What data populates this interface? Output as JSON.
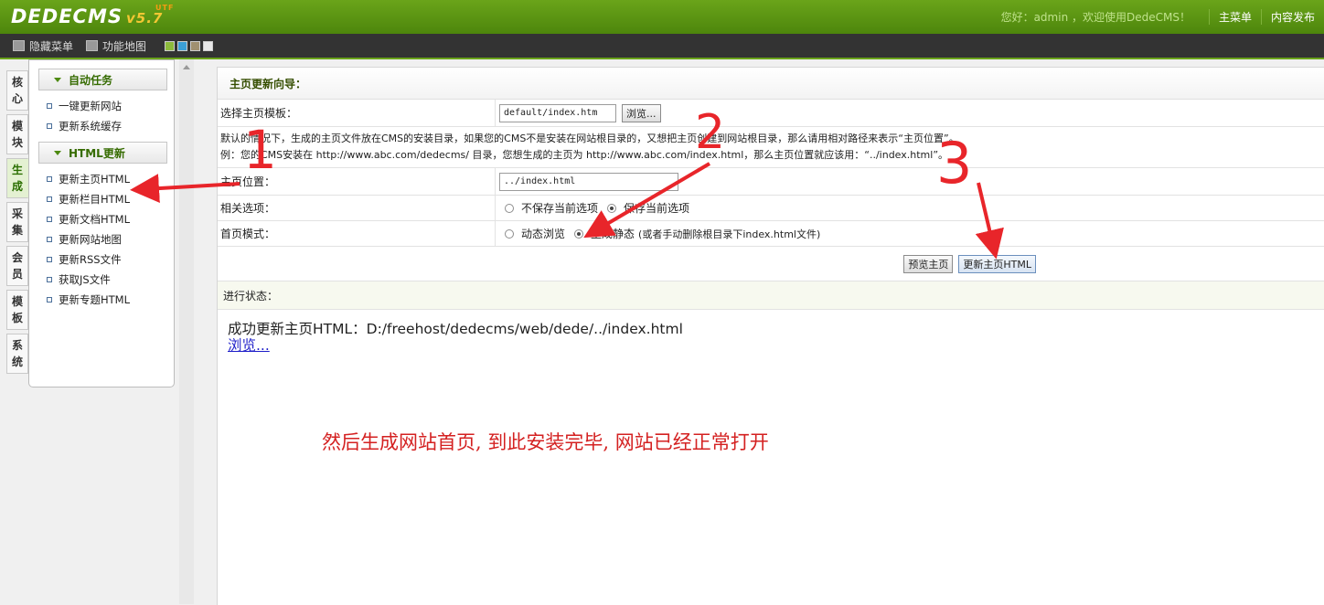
{
  "header": {
    "logo": "DEDECMS",
    "version": "v5.7",
    "edition": "UTF",
    "welcome": "您好：admin ，欢迎使用DedeCMS！",
    "nav": [
      "主菜单",
      "内容发布"
    ]
  },
  "toolbar": {
    "hide_menu": "隐藏菜单",
    "function_map": "功能地图",
    "swatches": [
      "#8dbb3c",
      "#3b9fd6",
      "#a09070",
      "#e8e8e8"
    ]
  },
  "side_tabs": [
    "核心",
    "模块",
    "生成",
    "采集",
    "会员",
    "模板",
    "系统"
  ],
  "active_tab": "生成",
  "menu": {
    "group1": {
      "title": "自动任务",
      "items": [
        "一键更新网站",
        "更新系统缓存"
      ]
    },
    "group2": {
      "title": "HTML更新",
      "items": [
        "更新主页HTML",
        "更新栏目HTML",
        "更新文档HTML",
        "更新网站地图",
        "更新RSS文件",
        "获取JS文件",
        "更新专题HTML"
      ]
    }
  },
  "main": {
    "title": "主页更新向导：",
    "template_label": "选择主页模板：",
    "template_value": "default/index.htm",
    "browse_button": "浏览...",
    "note_line1": "默认的情况下，生成的主页文件放在CMS的安装目录，如果您的CMS不是安装在网站根目录的，又想把主页创建到网站根目录，那么请用相对路径来表示“主页位置”。",
    "note_line2": "例：您的CMS安装在 http://www.abc.com/dedecms/ 目录，您想生成的主页为 http://www.abc.com/index.html，那么主页位置就应该用：“../index.html”。",
    "position_label": "主页位置：",
    "position_value": "../index.html",
    "options_label": "相关选项：",
    "option_no_save": "不保存当前选项",
    "option_save": "保存当前选项",
    "mode_label": "首页模式：",
    "mode_dynamic": "动态浏览",
    "mode_static": "生成静态",
    "mode_static_hint": "(或者手动删除根目录下index.html文件)",
    "preview_button": "预览主页",
    "update_button": "更新主页HTML",
    "status_label": "进行状态：",
    "result_text": "成功更新主页HTML：D:/freehost/dedecms/web/dede/../index.html",
    "result_link": "浏览..."
  },
  "annotations": {
    "caption": "然后生成网站首页, 到此安装完毕, 网站已经正常打开",
    "step1": "1",
    "step2": "2",
    "step3": "3"
  }
}
